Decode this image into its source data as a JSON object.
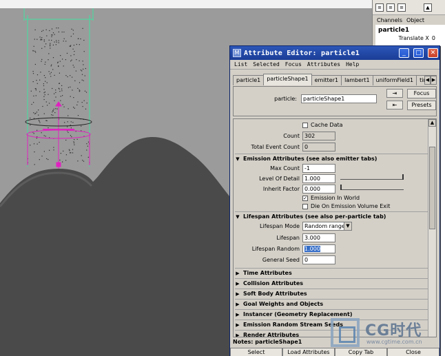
{
  "channel_box": {
    "menus": [
      "Channels",
      "Object"
    ],
    "object_name": "particle1",
    "rows": [
      {
        "label": "Translate X",
        "value": "0"
      }
    ]
  },
  "attribute_editor": {
    "title": "Attribute Editor: particle1",
    "menus": [
      "List",
      "Selected",
      "Focus",
      "Attributes",
      "Help"
    ],
    "tabs": [
      "particle1",
      "particleShape1",
      "emitter1",
      "lambert1",
      "uniformField1",
      "time1",
      "initi"
    ],
    "active_tab": 1,
    "header": {
      "label": "particle:",
      "value": "particleShape1",
      "focus_label": "Focus",
      "presets_label": "Presets"
    },
    "general": {
      "cache_data": {
        "label": "Cache Data",
        "checked": false
      },
      "count": {
        "label": "Count",
        "value": "302"
      },
      "total_event_count": {
        "label": "Total Event Count",
        "value": "0"
      }
    },
    "emission": {
      "title": "Emission Attributes (see also emitter tabs)",
      "max_count": {
        "label": "Max Count",
        "value": "-1"
      },
      "level_of_detail": {
        "label": "Level Of Detail",
        "value": "1.000",
        "slider": 1.0
      },
      "inherit_factor": {
        "label": "Inherit Factor",
        "value": "0.000",
        "slider": 0.0
      },
      "emission_in_world": {
        "label": "Emission In World",
        "checked": true
      },
      "die_on_exit": {
        "label": "Die On Emission Volume Exit",
        "checked": false
      }
    },
    "lifespan": {
      "title": "Lifespan Attributes (see also per-particle tab)",
      "mode": {
        "label": "Lifespan Mode",
        "value": "Random range"
      },
      "lifespan": {
        "label": "Lifespan",
        "value": "3.000"
      },
      "lifespan_random": {
        "label": "Lifespan Random",
        "value": "1.000"
      },
      "general_seed": {
        "label": "General Seed",
        "value": "0"
      }
    },
    "collapsed_sections": [
      "Time Attributes",
      "Collision Attributes",
      "Soft Body Attributes",
      "Goal Weights and Objects",
      "Instancer (Geometry Replacement)",
      "Emission Random Stream Seeds",
      "Render Attributes"
    ],
    "notes_label": "Notes:  particleShape1",
    "bottom_buttons": [
      "Select",
      "Load Attributes",
      "Copy Tab",
      "Close"
    ]
  },
  "watermark": {
    "text": "CG时代",
    "url": "www.cgtime.com.cn"
  },
  "colors": {
    "title_bar": "#2c56b8",
    "selection": "#316ac5",
    "viewport_bg": "#9b9b9b",
    "terrain": "#4a4a4a",
    "emitter_cylinder": "#40e0a0",
    "manipulator": "#e020c0"
  }
}
